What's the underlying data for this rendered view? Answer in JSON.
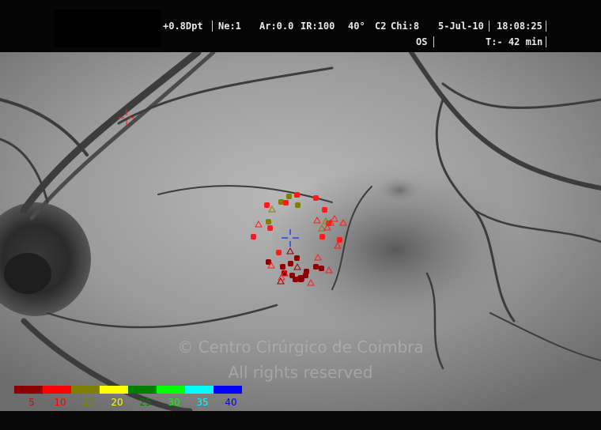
{
  "header": {
    "refraction": "+0.8Dpt",
    "ne": "Ne:1",
    "ar": "Ar:0.0",
    "ir": "IR:100",
    "angle": "40°",
    "c2": "C2",
    "chi": "Chi:8",
    "date": "5-Jul-10",
    "time": "18:08:25",
    "eye": "OS",
    "elapsed": "T:- 42 min"
  },
  "watermark": {
    "line1": "© Centro Cirúrgico de Coimbra",
    "line2": "All rights reserved"
  },
  "legend": {
    "scale": [
      {
        "label": "5",
        "color": "#8b0000"
      },
      {
        "label": "10",
        "color": "#ff0000"
      },
      {
        "label": "15",
        "color": "#808000"
      },
      {
        "label": "20",
        "color": "#ffff00"
      },
      {
        "label": "25",
        "color": "#008000"
      },
      {
        "label": "30",
        "color": "#00ff00"
      },
      {
        "label": "35",
        "color": "#00ffff"
      },
      {
        "label": "40",
        "color": "#0000ff"
      }
    ]
  },
  "markers": {
    "fixation_cross_color": "#1a3cff",
    "reference_cross_color": "#ff2020"
  }
}
